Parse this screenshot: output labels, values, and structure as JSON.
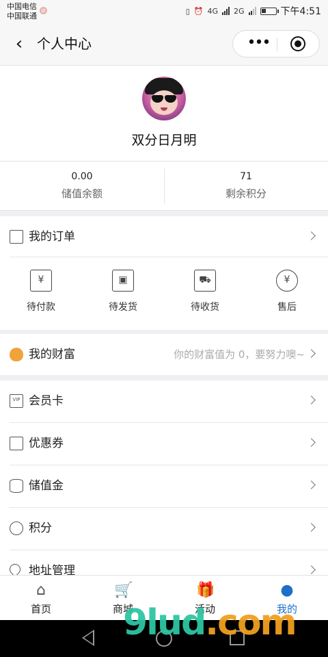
{
  "status_bar": {
    "carrier_1": "中国电信",
    "carrier_2": "中国联通",
    "network_1": "4G",
    "network_2": "2G",
    "time": "下午4:51"
  },
  "nav": {
    "title": "个人中心"
  },
  "profile": {
    "nickname": "双分日月明"
  },
  "stats": [
    {
      "value": "0.00",
      "label": "储值余额"
    },
    {
      "value": "71",
      "label": "剩余积分"
    }
  ],
  "orders": {
    "title": "我的订单",
    "items": [
      {
        "label": "待付款",
        "icon": "payment-pending-icon",
        "glyph": "¥"
      },
      {
        "label": "待发货",
        "icon": "package-icon",
        "glyph": "▣"
      },
      {
        "label": "待收货",
        "icon": "truck-icon",
        "glyph": "⛟"
      },
      {
        "label": "售后",
        "icon": "refund-icon",
        "glyph": "¥"
      }
    ]
  },
  "wealth": {
    "title": "我的财富",
    "hint": "你的财富值为 0，要努力噢~"
  },
  "menu": [
    {
      "label": "会员卡",
      "icon": "vip-card-icon"
    },
    {
      "label": "优惠券",
      "icon": "coupon-icon"
    },
    {
      "label": "储值金",
      "icon": "coins-icon"
    },
    {
      "label": "积分",
      "icon": "piggy-bank-icon"
    },
    {
      "label": "地址管理",
      "icon": "location-icon"
    }
  ],
  "tabbar": [
    {
      "label": "首页",
      "icon": "home-icon",
      "glyph": "⌂"
    },
    {
      "label": "商城",
      "icon": "cart-icon",
      "glyph": "🛒"
    },
    {
      "label": "活动",
      "icon": "gift-icon",
      "glyph": "🎁"
    },
    {
      "label": "我的",
      "icon": "user-icon",
      "glyph": "●"
    }
  ],
  "active_tab": "我的",
  "colors": {
    "accent": "#1d6fc8",
    "wealth_icon": "#f0a33a",
    "watermark": "#2dc7a3"
  },
  "watermark": {
    "text": "9lud",
    "suffix": ".com"
  }
}
